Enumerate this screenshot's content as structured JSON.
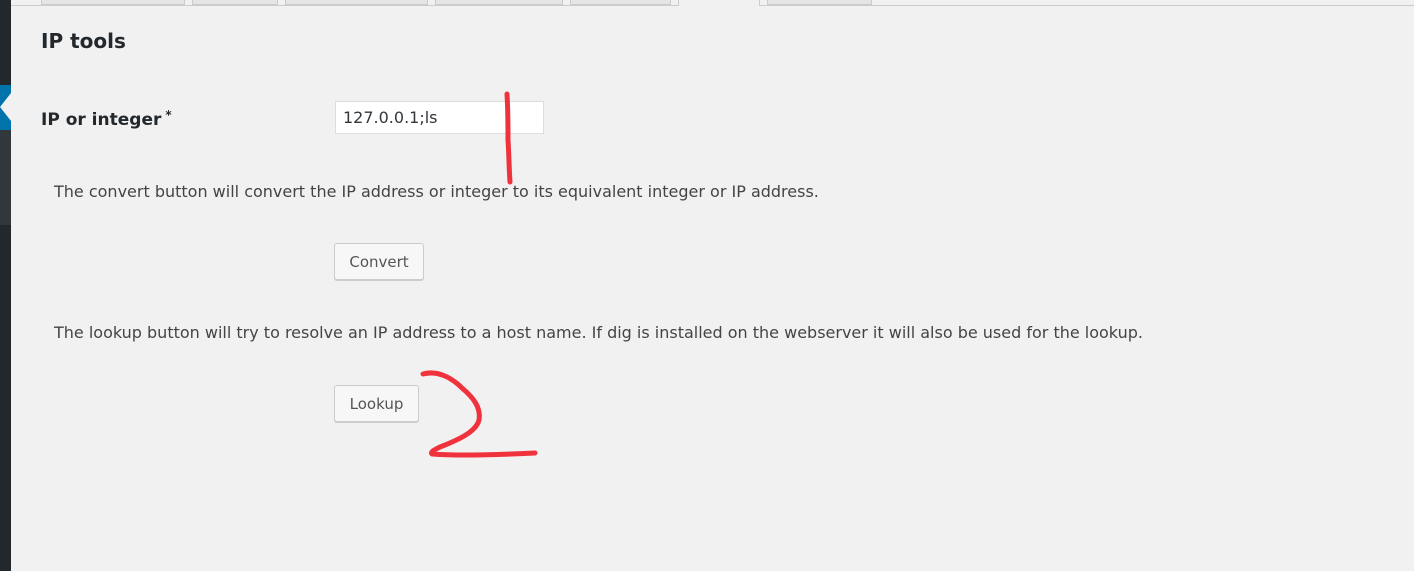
{
  "page": {
    "section_title": "IP tools"
  },
  "form": {
    "field_label": "IP or integer",
    "required_marker": "*",
    "input_value": "127.0.0.1;ls"
  },
  "convert": {
    "help_text": "The convert button will convert the IP address or integer to its equivalent integer or IP address.",
    "button_label": "Convert"
  },
  "lookup": {
    "help_text": "The lookup button will try to resolve an IP address to a host name. If dig is installed on the webserver it will also be used for the lookup.",
    "button_label": "Lookup"
  },
  "colors": {
    "annotation": "#f0323c",
    "sidebar": "#23282d",
    "sidebar_active": "#0073aa",
    "background": "#f1f1f1"
  }
}
